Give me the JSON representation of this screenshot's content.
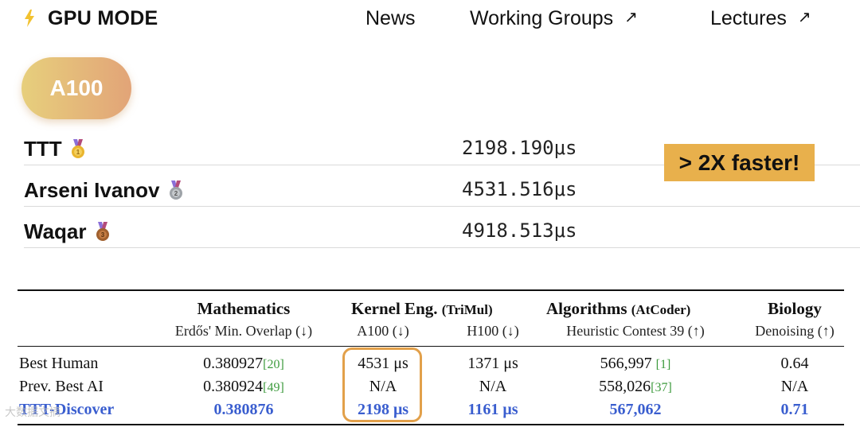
{
  "nav": {
    "brand": "GPU MODE",
    "items": [
      {
        "label": "News",
        "external": false
      },
      {
        "label": "Working Groups",
        "external": true
      },
      {
        "label": "Lectures",
        "external": true
      }
    ],
    "external_arrow": "↗"
  },
  "gpu_pill": "A100",
  "leaderboard": [
    {
      "name": "TTT",
      "medal": "gold",
      "time": "2198.190μs"
    },
    {
      "name": "Arseni Ivanov",
      "medal": "silver",
      "time": "4531.516μs"
    },
    {
      "name": "Waqar",
      "medal": "bronze",
      "time": "4918.513μs"
    }
  ],
  "callout": "> 2X faster!",
  "results": {
    "headers": {
      "math": "Mathematics",
      "kernel": "Kernel Eng.",
      "kernel_sub": "(TriMul)",
      "algo": "Algorithms",
      "algo_sub": "(AtCoder)",
      "bio": "Biology"
    },
    "subheaders": {
      "math": "Erdős' Min. Overlap (↓)",
      "a100": "A100 (↓)",
      "h100": "H100 (↓)",
      "algo": "Heuristic Contest 39 (↑)",
      "bio": "Denoising (↑)"
    },
    "rows": [
      {
        "label": "Best Human",
        "math": "0.380927",
        "math_ref": "[20]",
        "a100": "4531 μs",
        "h100": "1371 μs",
        "algo": "566,997",
        "algo_ref": "[1]",
        "bio": "0.64"
      },
      {
        "label": "Prev. Best AI",
        "math": "0.380924",
        "math_ref": "[49]",
        "a100": "N/A",
        "h100": "N/A",
        "algo": "558,026",
        "algo_ref": "[37]",
        "bio": "N/A"
      },
      {
        "label": "TTT-Discover",
        "math": "0.380876",
        "math_ref": "",
        "a100": "2198 μs",
        "h100": "1161 μs",
        "algo": "567,062",
        "algo_ref": "",
        "bio": "0.71"
      }
    ]
  },
  "colors": {
    "accent_blue": "#3a5ecf",
    "ref_green": "#3e9b3e",
    "highlight_orange": "#e2a04a",
    "callout_bg": "#e8b04c",
    "pill_gradient_start": "#e7cf7c",
    "pill_gradient_end": "#e2a478"
  },
  "watermark": "大数据文摘"
}
